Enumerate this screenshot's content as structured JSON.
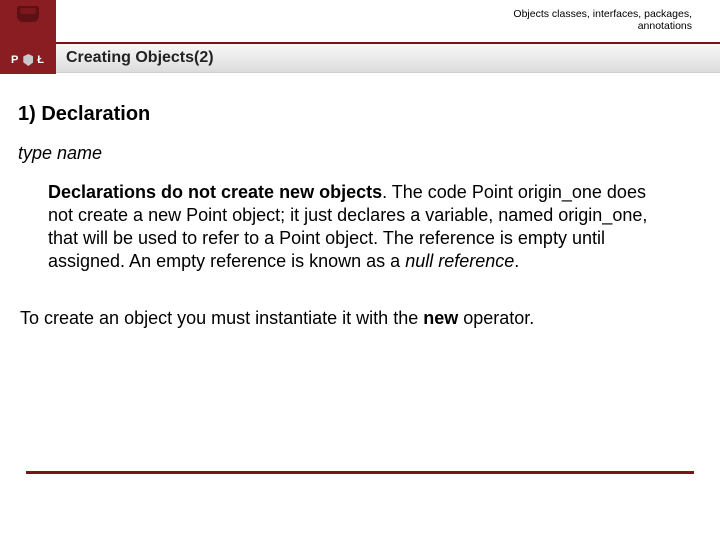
{
  "header": {
    "breadcrumb_line1": "Objects classes, interfaces, packages,",
    "breadcrumb_line2": "annotations",
    "logo_left": "P",
    "logo_right": "Ł",
    "title": "Creating Objects(2)"
  },
  "body": {
    "section_heading": "1) Declaration",
    "type_name": "type name",
    "p1_lead_bold": "Declarations do not create new objects",
    "p1_after_lead": ". The code Point origin_one does not create a new Point object; it just declares a variable, named origin_one, that will be used to refer to a Point object. The reference is empty until assigned. An empty reference is known as a ",
    "p1_italic_tail": "null reference",
    "p1_period": ".",
    "p2_before_bold": "To create an object you must instantiate it with the ",
    "p2_bold": "new",
    "p2_after_bold": " operator."
  }
}
